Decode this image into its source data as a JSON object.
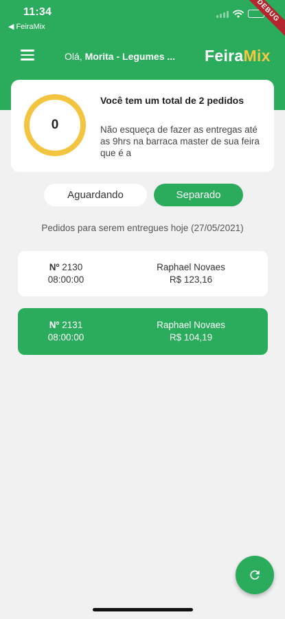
{
  "status_bar": {
    "time": "11:34",
    "back_app": "◀ FeiraMix"
  },
  "debug_banner": "DEBUG",
  "header": {
    "greeting_prefix": "Olá,",
    "store_name": "Morita - Legumes ...",
    "logo_part1": "Feira",
    "logo_part2": "Mix"
  },
  "summary": {
    "count": "0",
    "title": "Você tem um total de 2 pedidos",
    "message": "Não esqueça de fazer as entregas até as 9hrs na barraca master de sua feira que é a"
  },
  "tabs": [
    {
      "label": "Aguardando",
      "active": false
    },
    {
      "label": "Separado",
      "active": true
    }
  ],
  "day_label": "Pedidos para serem entregues hoje (27/05/2021)",
  "orders": [
    {
      "number_prefix": "Nº",
      "number": "2130",
      "time": "08:00:00",
      "customer": "Raphael Novaes",
      "total": "R$ 123,16",
      "selected": false
    },
    {
      "number_prefix": "Nº",
      "number": "2131",
      "time": "08:00:00",
      "customer": "Raphael Novaes",
      "total": "R$ 104,19",
      "selected": true
    }
  ],
  "colors": {
    "primary": "#2bab5c",
    "accent": "#f2c440",
    "background": "#f1f1f1"
  },
  "icons": {
    "menu": "menu-icon",
    "refresh": "refresh-icon"
  }
}
